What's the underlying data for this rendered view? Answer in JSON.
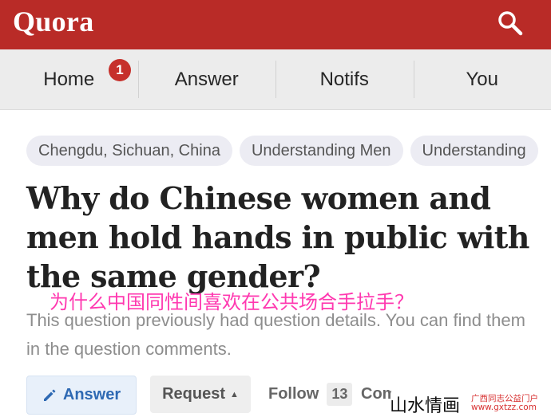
{
  "header": {
    "logo": "Quora",
    "search_icon": "search-icon"
  },
  "nav": {
    "items": [
      {
        "label": "Home",
        "badge": "1"
      },
      {
        "label": "Answer"
      },
      {
        "label": "Notifs"
      },
      {
        "label": "You"
      }
    ]
  },
  "topics": [
    "Chengdu, Sichuan, China",
    "Understanding Men",
    "Understanding"
  ],
  "question": {
    "title": "Why do Chinese women and men hold hands in public with the same gender?",
    "overlay_translation": "为什么中国同性间喜欢在公共场合手拉手？",
    "details": "This question previously had question details. You can find them in the question comments."
  },
  "actions": {
    "answer": "Answer",
    "request": "Request",
    "follow": "Follow",
    "follow_count": "13",
    "comments": "Comments"
  },
  "watermark": {
    "main": "山水情画",
    "sub1": "广西同志公益门户",
    "sub2": "www.gxtzz.com"
  },
  "colors": {
    "brand_red": "#b92b27",
    "badge_red": "#c6302b",
    "answer_blue": "#2e69b3",
    "overlay_pink": "#ff39b0"
  }
}
